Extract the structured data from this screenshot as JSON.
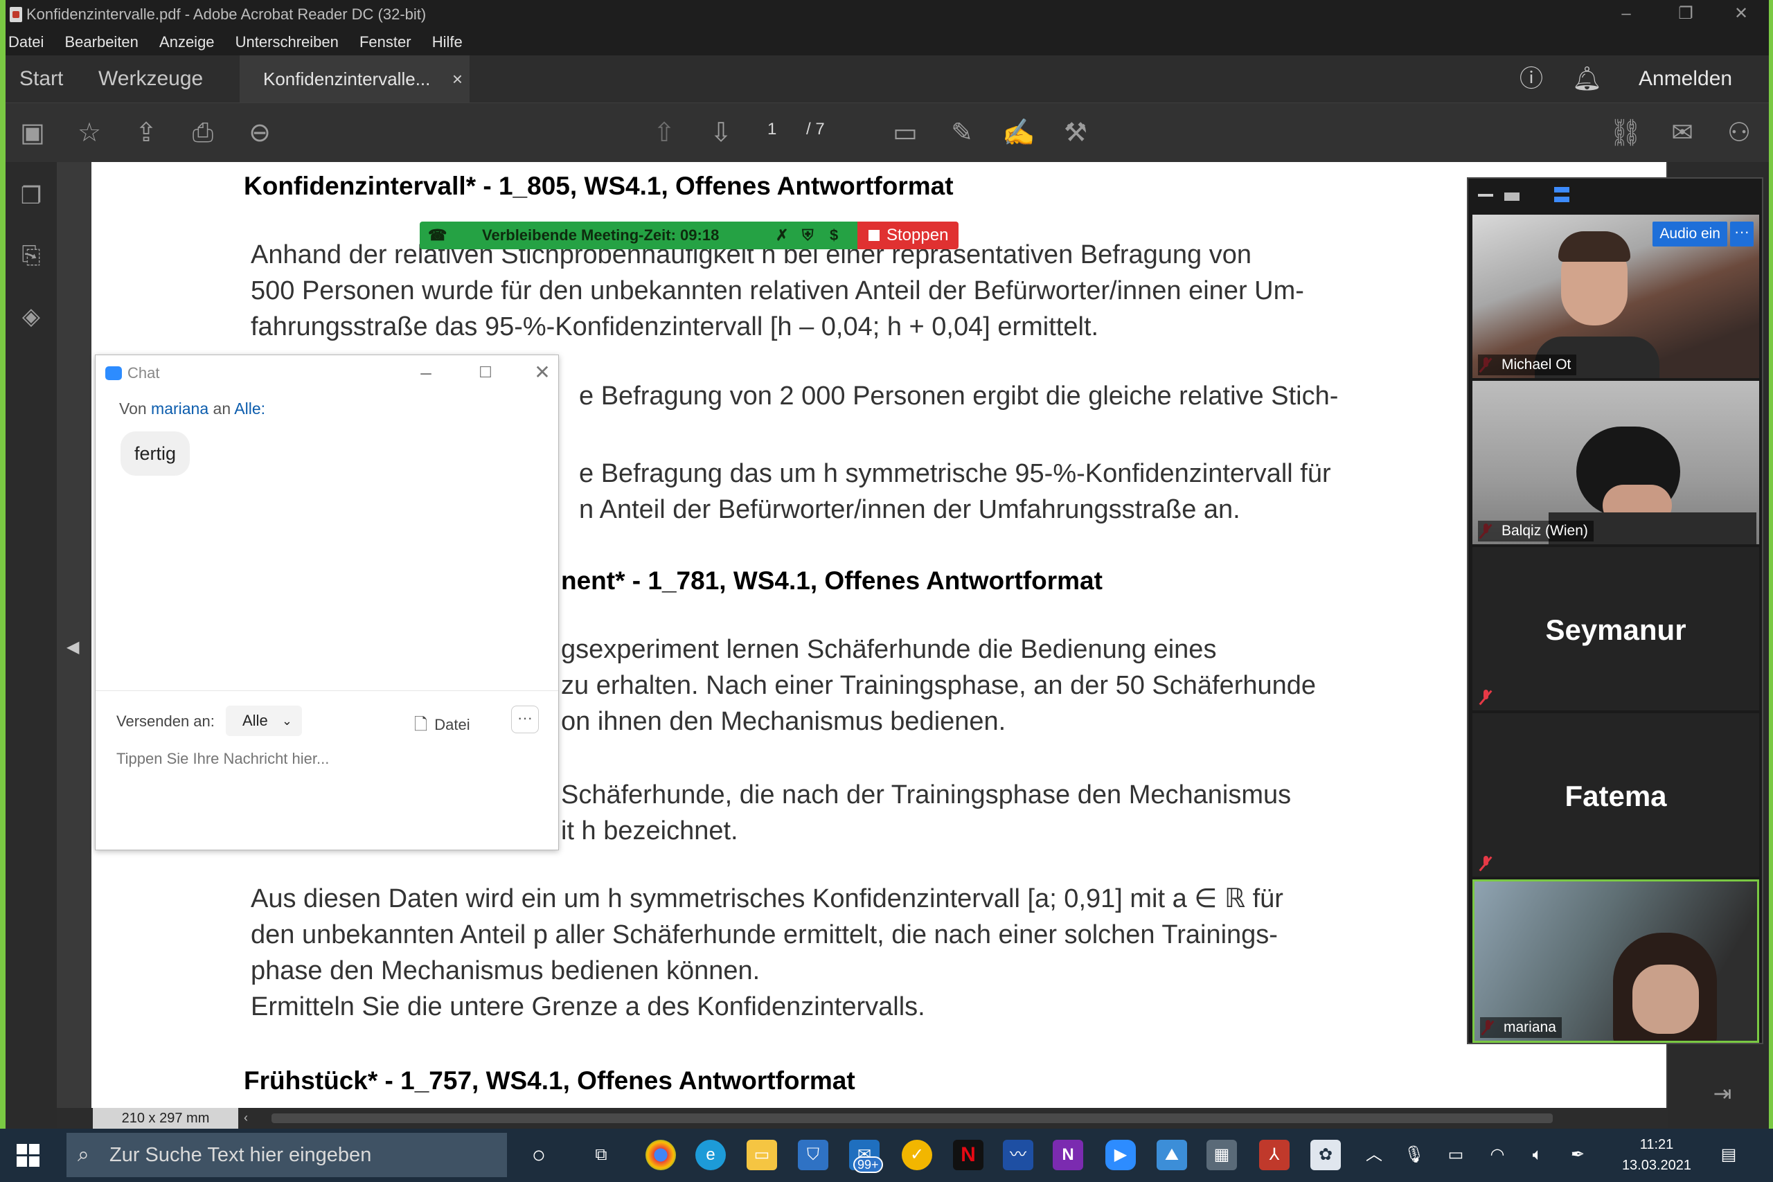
{
  "window": {
    "title": "Konfidenzintervalle.pdf - Adobe Acrobat Reader DC (32-bit)",
    "menu": [
      "Datei",
      "Bearbeiten",
      "Anzeige",
      "Unterschreiben",
      "Fenster",
      "Hilfe"
    ]
  },
  "tabs": {
    "home": "Start",
    "tools": "Werkzeuge",
    "document": "Konfidenzintervalle...",
    "close_glyph": "×",
    "signin": "Anmelden"
  },
  "toolbar": {
    "current_page": "1",
    "total_pages": "/ 7"
  },
  "pdf": {
    "heading1": "Konfidenzintervall* - 1_805, WS4.1, Offenes Antwortformat",
    "p1": [
      "Anhand der relativen Stichprobenhäufigkeit h bei einer repräsentativen Befragung von",
      "500 Personen wurde für den unbekannten relativen Anteil der Befürworter/innen einer Um-",
      "fahrungsstraße das 95-%-Konfidenzintervall [h – 0,04; h + 0,04] ermittelt."
    ],
    "p2": "e Befragung von 2 000 Personen ergibt die gleiche relative Stich-",
    "p3": [
      "e Befragung das um h symmetrische 95-%-Konfidenzintervall für",
      "n Anteil der Befürworter/innen der Umfahrungsstraße an."
    ],
    "heading2": "nent* - 1_781, WS4.1, Offenes Antwortformat",
    "p4": [
      "gsexperiment lernen Schäferhunde die Bedienung eines",
      "zu erhalten. Nach einer Trainingsphase, an der 50 Schäferhunde",
      "on ihnen den Mechanismus bedienen."
    ],
    "p5": [
      "Schäferhunde, die nach der Trainingsphase den Mechanismus",
      "it h bezeichnet."
    ],
    "p6": [
      "Aus diesen Daten wird ein um h symmetrisches Konfidenzintervall [a; 0,91] mit  a ∈ ℝ  für",
      "den unbekannten Anteil p aller Schäferhunde ermittelt, die nach einer solchen Trainings-",
      "phase den Mechanismus bedienen können.",
      "Ermitteln Sie die untere Grenze a des Konfidenzintervalls."
    ],
    "heading3": "Frühstück* - 1_757, WS4.1, Offenes Antwortformat",
    "page_size": "210 x 297 mm"
  },
  "meeting_bar": {
    "remaining": "Verbleibende Meeting-Zeit: 09:18",
    "stop": "Stoppen"
  },
  "chat": {
    "title": "Chat",
    "from_prefix": "Von",
    "from_user": "mariana",
    "to_prefix": "an",
    "to_user": "Alle:",
    "message": "fertig",
    "send_to_label": "Versenden an:",
    "send_to_value": "Alle",
    "file_label": "Datei",
    "more": "···",
    "placeholder": "Tippen Sie Ihre Nachricht hier..."
  },
  "zoom": {
    "audio_button": "Audio ein",
    "more_button": "···",
    "participants": [
      {
        "name": "Michael Ot",
        "video": true,
        "muted": true
      },
      {
        "name": "Balqiz (Wien)",
        "video": true,
        "muted": true
      },
      {
        "name": "Seymanur",
        "video": false,
        "muted": true
      },
      {
        "name": "Fatema",
        "video": false,
        "muted": true
      },
      {
        "name": "mariana",
        "video": true,
        "muted": true
      }
    ]
  },
  "taskbar": {
    "search_placeholder": "Zur Suche Text hier eingeben",
    "mail_badge": "99+",
    "time": "11:21",
    "date": "13.03.2021"
  },
  "colors": {
    "meeting_green": "#25a244",
    "meeting_red": "#e03131",
    "zoom_blue": "#1e6fd9",
    "link_blue": "#0b5cad",
    "frame_green": "#7ac943"
  }
}
